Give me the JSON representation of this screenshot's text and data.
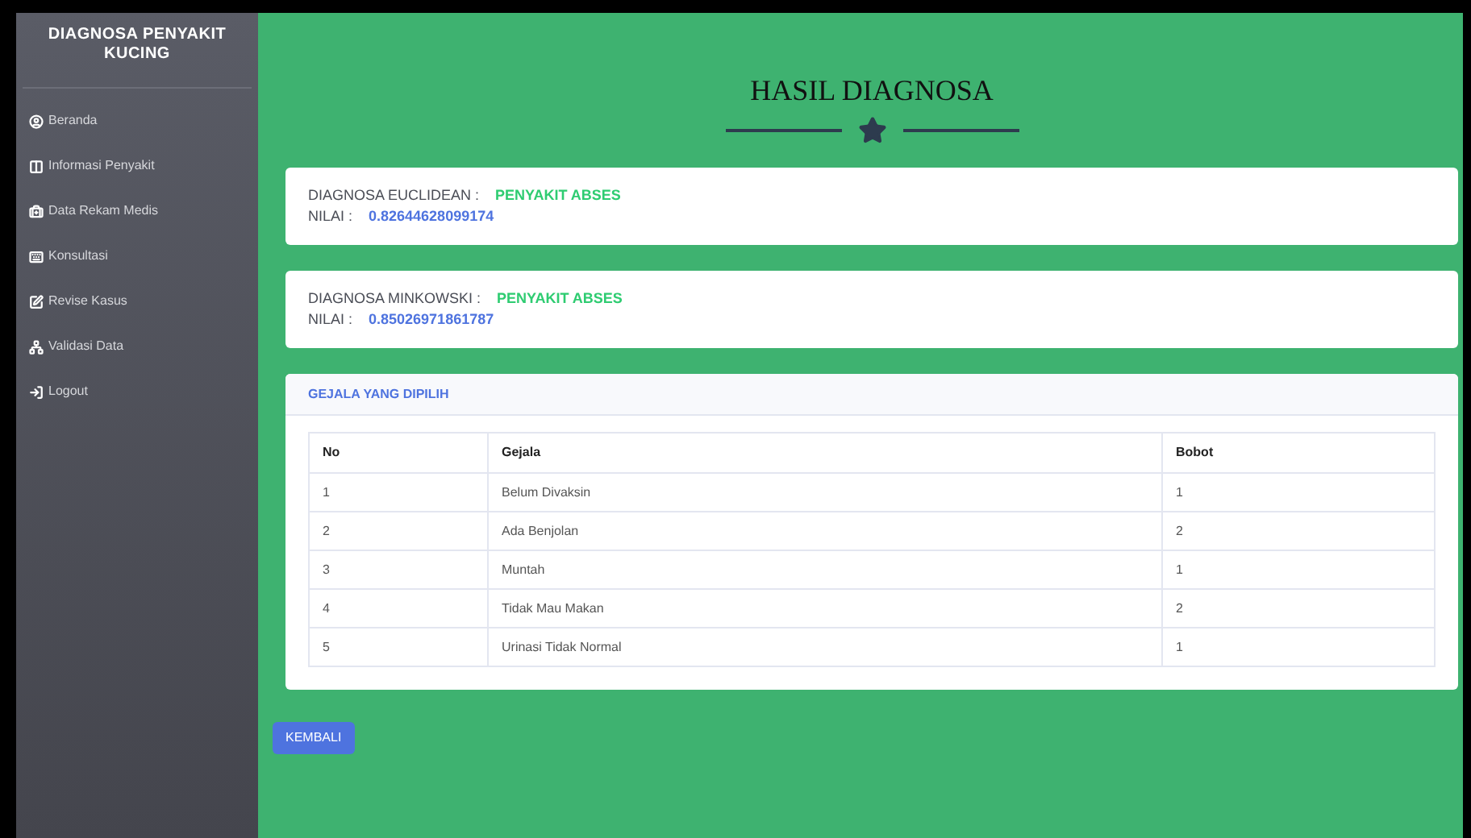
{
  "sidebar": {
    "brand": "DIAGNOSA PENYAKIT KUCING",
    "items": [
      {
        "label": "Beranda"
      },
      {
        "label": "Informasi Penyakit"
      },
      {
        "label": "Data Rekam Medis"
      },
      {
        "label": "Konsultasi"
      },
      {
        "label": "Revise Kasus"
      },
      {
        "label": "Validasi Data"
      },
      {
        "label": "Logout"
      }
    ]
  },
  "page_title": "HASIL DIAGNOSA",
  "results": [
    {
      "label": "DIAGNOSA EUCLIDEAN :",
      "diagnosis": "PENYAKIT ABSES",
      "score_label": "NILAI :",
      "score": "0.82644628099174"
    },
    {
      "label": "DIAGNOSA MINKOWSKI :",
      "diagnosis": "PENYAKIT ABSES",
      "score_label": "NILAI :",
      "score": "0.85026971861787"
    }
  ],
  "symptoms": {
    "title": "GEJALA YANG DIPILIH",
    "columns": [
      "No",
      "Gejala",
      "Bobot"
    ],
    "rows": [
      [
        "1",
        "Belum Divaksin",
        "1"
      ],
      [
        "2",
        "Ada Benjolan",
        "2"
      ],
      [
        "3",
        "Muntah",
        "1"
      ],
      [
        "4",
        "Tidak Mau Makan",
        "2"
      ],
      [
        "5",
        "Urinasi Tidak Normal",
        "1"
      ]
    ]
  },
  "back_button": "KEMBALI"
}
